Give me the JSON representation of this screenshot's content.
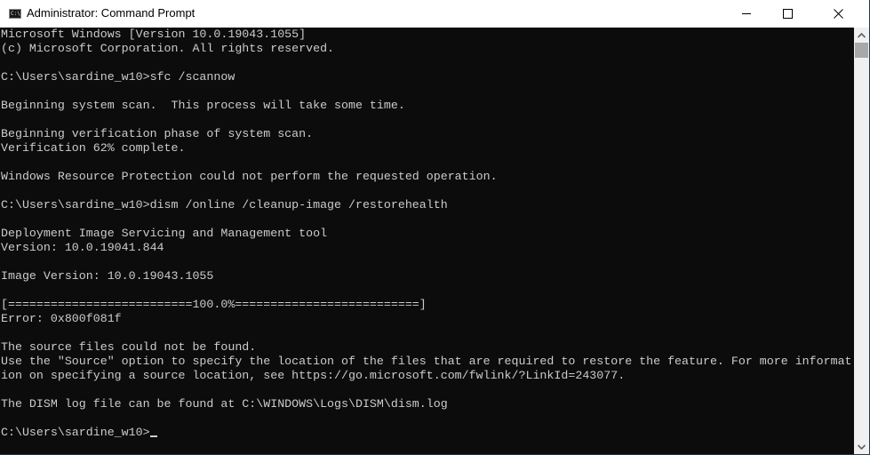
{
  "window": {
    "title": "Administrator: Command Prompt",
    "icon": "cmd-icon",
    "icon_text": "C:\\",
    "controls": {
      "minimize": "minimize-icon",
      "maximize": "maximize-icon",
      "close": "close-icon"
    }
  },
  "console": {
    "lines": [
      "Microsoft Windows [Version 10.0.19043.1055]",
      "(c) Microsoft Corporation. All rights reserved.",
      "",
      "C:\\Users\\sardine_w10>sfc /scannow",
      "",
      "Beginning system scan.  This process will take some time.",
      "",
      "Beginning verification phase of system scan.",
      "Verification 62% complete.",
      "",
      "Windows Resource Protection could not perform the requested operation.",
      "",
      "C:\\Users\\sardine_w10>dism /online /cleanup-image /restorehealth",
      "",
      "Deployment Image Servicing and Management tool",
      "Version: 10.0.19041.844",
      "",
      "Image Version: 10.0.19043.1055",
      "",
      "[==========================100.0%==========================]",
      "Error: 0x800f081f",
      "",
      "The source files could not be found.",
      "Use the \"Source\" option to specify the location of the files that are required to restore the feature. For more informat",
      "ion on specifying a source location, see https://go.microsoft.com/fwlink/?LinkId=243077.",
      "",
      "The DISM log file can be found at C:\\WINDOWS\\Logs\\DISM\\dism.log",
      "",
      "C:\\Users\\sardine_w10>"
    ],
    "prompt": "C:\\Users\\sardine_w10>"
  }
}
